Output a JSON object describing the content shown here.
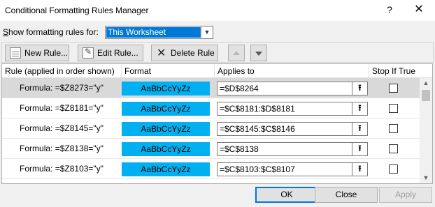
{
  "window": {
    "title": "Conditional Formatting Rules Manager",
    "help": "?",
    "close": "✕"
  },
  "scope": {
    "label": "Show formatting rules for:",
    "value": "This Worksheet"
  },
  "toolbar": {
    "new_rule": "New Rule...",
    "edit_rule": "Edit Rule...",
    "delete_rule": "Delete Rule"
  },
  "table": {
    "headers": [
      "Rule (applied in order shown)",
      "Format",
      "Applies to",
      "Stop If True"
    ],
    "rows": [
      {
        "rule": "Formula: =$Z8273=\"y\"",
        "format": "AaBbCcYyZz",
        "applies": "=$D$8264",
        "stop": false,
        "selected": true
      },
      {
        "rule": "Formula: =$Z8181=\"y\"",
        "format": "AaBbCcYyZz",
        "applies": "=$C$8181:$D$8181",
        "stop": false,
        "selected": false
      },
      {
        "rule": "Formula: =$Z8145=\"y\"",
        "format": "AaBbCcYyZz",
        "applies": "=$C$8145:$C$8146",
        "stop": false,
        "selected": false
      },
      {
        "rule": "Formula: =$Z8138=\"y\"",
        "format": "AaBbCcYyZz",
        "applies": "=$C$8138",
        "stop": false,
        "selected": false
      },
      {
        "rule": "Formula: =$Z8103=\"y\"",
        "format": "AaBbCcYyZz",
        "applies": "=$C$8103:$C$8107",
        "stop": false,
        "selected": false
      }
    ]
  },
  "buttons": {
    "ok": "OK",
    "close": "Close",
    "apply": "Apply"
  },
  "colors": {
    "format_preview": "#00b0f0",
    "selection": "#0078d7"
  },
  "icons": {
    "new_rule": "new-rule-icon",
    "edit_rule": "edit-rule-icon",
    "delete_rule": "delete-x-icon",
    "collapse": "collapse-dialog-icon"
  }
}
